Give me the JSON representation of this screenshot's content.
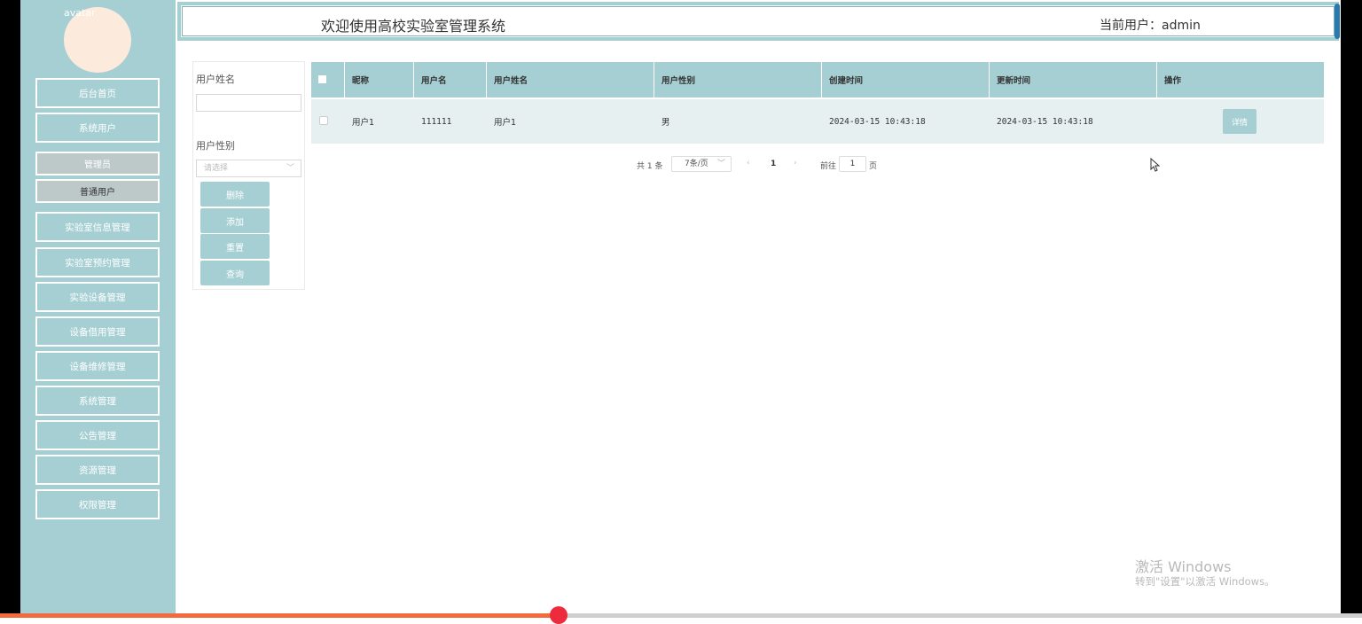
{
  "header": {
    "title": "欢迎使用高校实验室管理系统",
    "current_user": "当前用户：admin"
  },
  "sidebar": {
    "avatar_alt": "avatar",
    "items": [
      {
        "label": "后台首页"
      },
      {
        "label": "系统用户"
      },
      {
        "label": "管理员"
      },
      {
        "label": "普通用户"
      },
      {
        "label": "实验室信息管理"
      },
      {
        "label": "实验室预约管理"
      },
      {
        "label": "实验设备管理"
      },
      {
        "label": "设备借用管理"
      },
      {
        "label": "设备维修管理"
      },
      {
        "label": "系统管理"
      },
      {
        "label": "公告管理"
      },
      {
        "label": "资源管理"
      },
      {
        "label": "权限管理"
      }
    ]
  },
  "filter": {
    "name_label": "用户姓名",
    "name_value": "",
    "gender_label": "用户性别",
    "gender_placeholder": "请选择",
    "buttons": {
      "delete": "删除",
      "add": "添加",
      "reset": "重置",
      "query": "查询"
    }
  },
  "table": {
    "columns": [
      "昵称",
      "用户名",
      "用户姓名",
      "用户性别",
      "创建时间",
      "更新时间",
      "操作"
    ],
    "rows": [
      {
        "nickname": "用户1",
        "username": "111111",
        "realname": "用户1",
        "gender": "男",
        "created": "2024-03-15 10:43:18",
        "updated": "2024-03-15 10:43:18",
        "action": "详情"
      }
    ]
  },
  "pagination": {
    "total": "共 1 条",
    "page_size": "7条/页",
    "prev": "‹",
    "current": "1",
    "next": "›",
    "goto_label": "前往",
    "goto_value": "1",
    "goto_unit": "页"
  },
  "watermark": {
    "line1": "激活 Windows",
    "line2": "转到\"设置\"以激活 Windows。"
  },
  "media_progress": 0.41,
  "colors": {
    "accent": "#a6cfd3",
    "progress": "#f26a3d",
    "knob": "#ee2b3c"
  }
}
